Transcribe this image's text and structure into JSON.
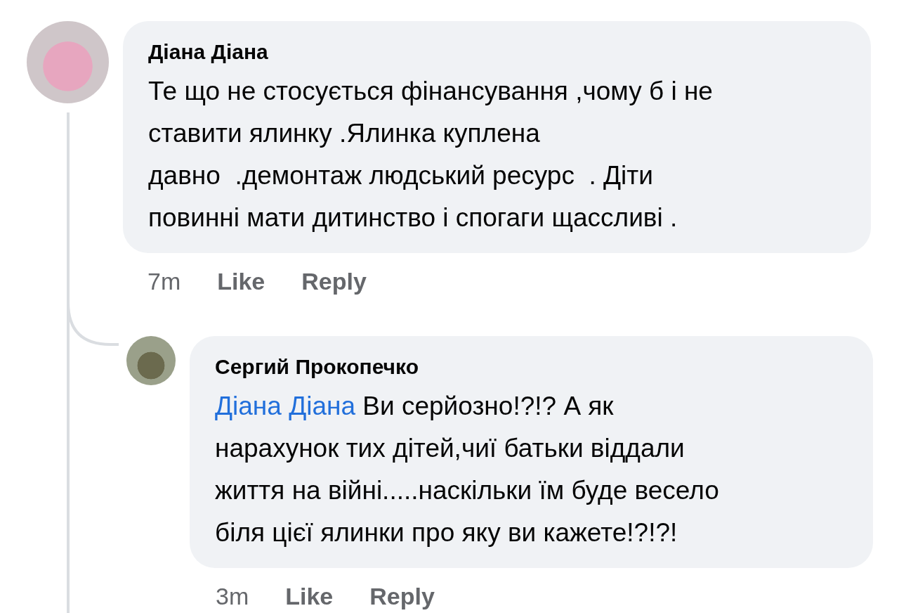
{
  "comments": [
    {
      "kind": "comment",
      "author": "Діана Діана",
      "text": "Те що не стосується фінансування ,чому б і не\nставити ялинку .Ялинка куплена\nдавно  .демонтаж людський ресурс  . Діти\nповинні мати дитинство і спогаги щассливі .",
      "time": "7m",
      "like": "Like",
      "reply": "Reply"
    },
    {
      "kind": "reply",
      "author": "Сергий Прокопечко",
      "mention": "Діана Діана",
      "text": " Ви серйозно!?!? А як\nнарахунок тих дітей,чиї батьки віддали\nжиття на війні.....наскільки їм буде весело\nбіля цієї ялинки про яку ви кажете!?!?!",
      "time": "3m",
      "like": "Like",
      "reply": "Reply"
    }
  ]
}
